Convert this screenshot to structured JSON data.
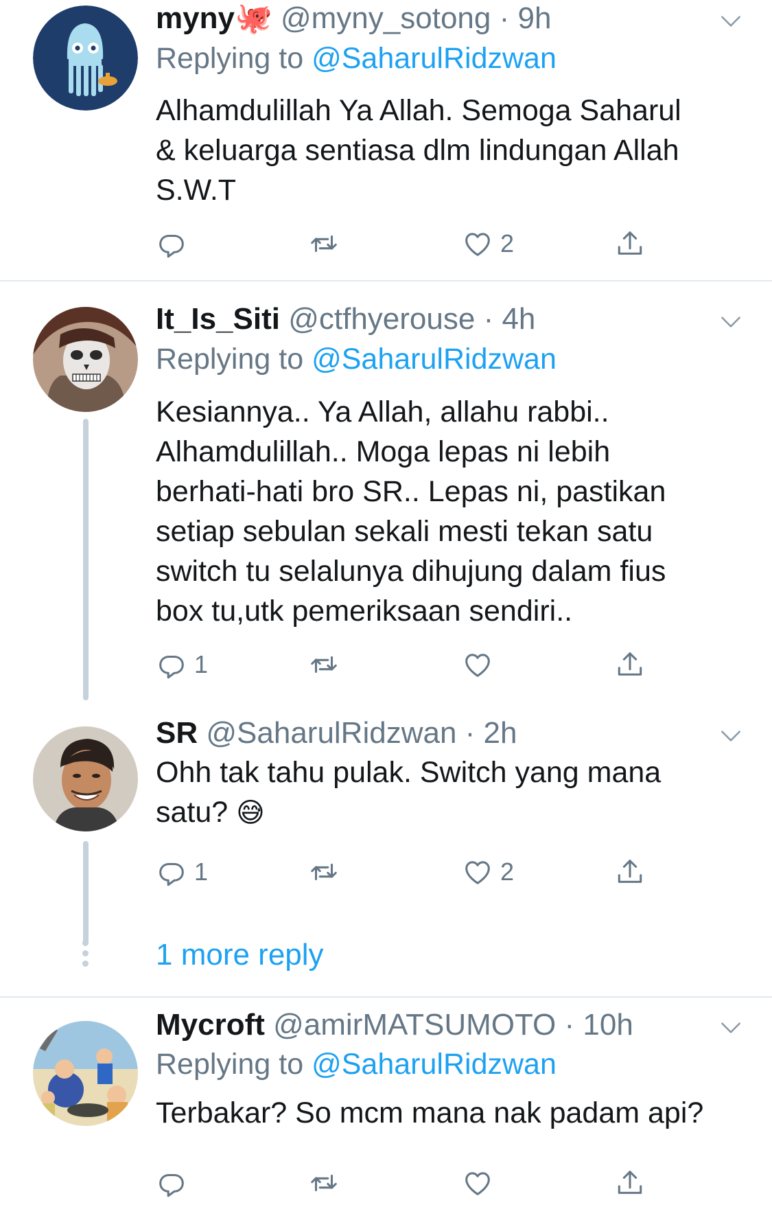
{
  "tweets": [
    {
      "name": "myny",
      "name_emoji": "🐙",
      "handle": "@myny_sotong",
      "time": "9h",
      "replying_prefix": "Replying to",
      "replying_to": "@SaharulRidzwan",
      "text_lines": [
        "Alhamdulillah Ya Allah. Semoga Saharul",
        "& keluarga sentiasa dlm lindungan Allah",
        "S.W.T"
      ],
      "reply_count": "",
      "like_count": "2"
    },
    {
      "name": "It_Is_Siti",
      "handle": "@ctfhyerouse",
      "time": "4h",
      "replying_prefix": "Replying to",
      "replying_to": "@SaharulRidzwan",
      "text_lines": [
        "Kesiannya.. Ya Allah, allahu rabbi..",
        "Alhamdulillah.. Moga lepas ni lebih",
        "berhati-hati bro SR..  Lepas ni, pastikan",
        "setiap sebulan sekali mesti tekan satu",
        "switch tu selalunya dihujung dalam fius",
        "box tu,utk pemeriksaan sendiri.."
      ],
      "reply_count": "1",
      "like_count": ""
    },
    {
      "name": "SR",
      "handle": "@SaharulRidzwan",
      "time": "2h",
      "text_lines": [
        "Ohh tak tahu pulak. Switch yang mana",
        "satu?"
      ],
      "text_emoji": "😅",
      "reply_count": "1",
      "like_count": "2"
    },
    {
      "name": "Mycroft",
      "handle": "@amirMATSUMOTO",
      "time": "10h",
      "replying_prefix": "Replying to",
      "replying_to": "@SaharulRidzwan",
      "text_lines": [
        "Terbakar? So mcm mana nak padam api?"
      ],
      "reply_count": "",
      "like_count": ""
    }
  ],
  "more_replies": "1 more reply",
  "separator": "·",
  "colors": {
    "link": "#1da1f2",
    "secondary": "#657786",
    "text": "#14171a",
    "divider": "#e1e8ed"
  },
  "icons": [
    "reply-icon",
    "retweet-icon",
    "like-icon",
    "share-icon",
    "chevron-down-icon"
  ]
}
